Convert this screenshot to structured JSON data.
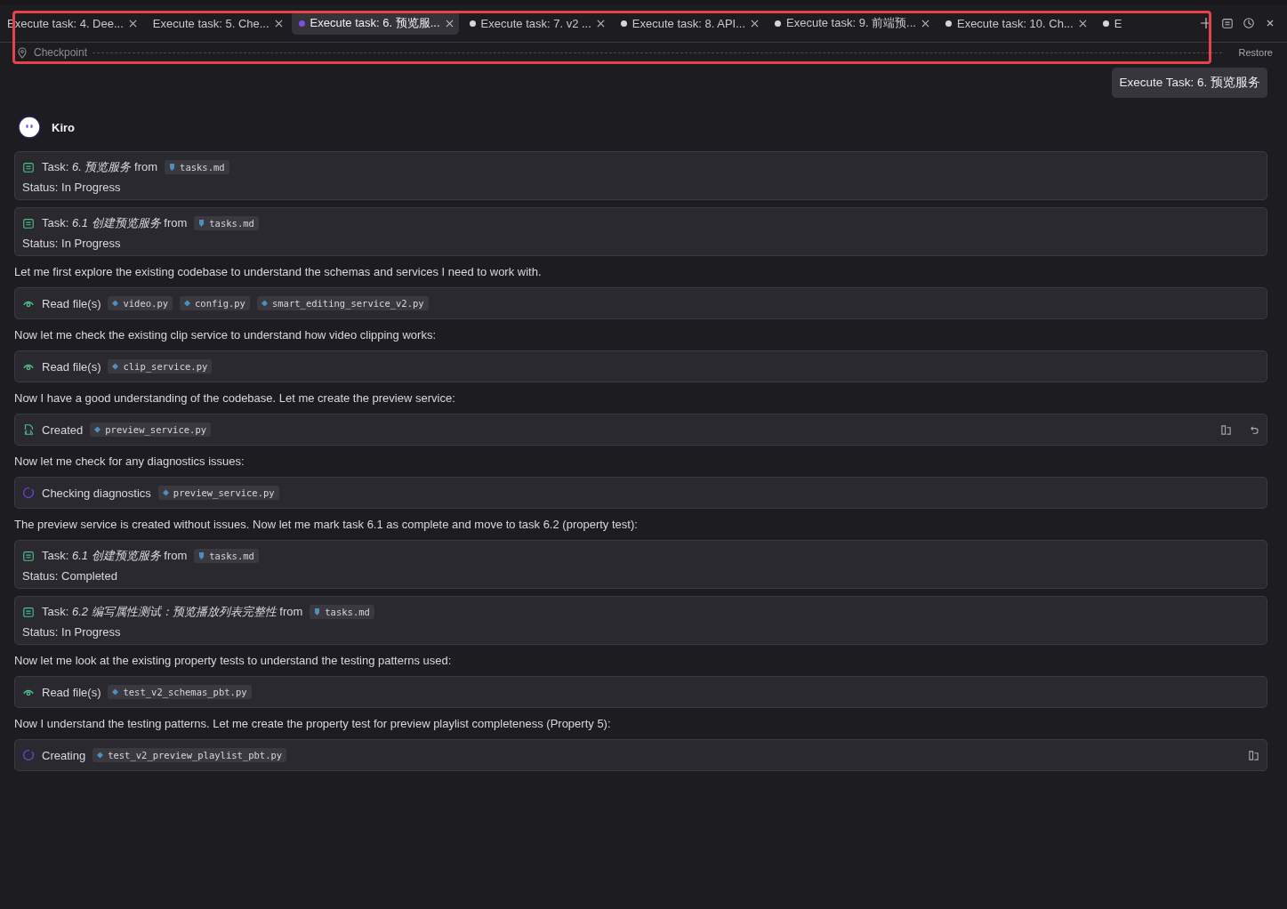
{
  "tabs": [
    {
      "label": "Execute task: 4. Dee...",
      "selected": false
    },
    {
      "label": "Execute task: 5. Che...",
      "selected": false
    },
    {
      "label": "Execute task: 6. 预览服...",
      "selected": true,
      "color": "#7b4fe0"
    },
    {
      "label": "Execute task: 7. v2 ...",
      "selected": false,
      "color": "#d6d6d8"
    },
    {
      "label": "Execute task: 8. API...",
      "selected": false,
      "color": "#d6d6d8"
    },
    {
      "label": "Execute task: 9. 前端预...",
      "selected": false,
      "color": "#d6d6d8"
    },
    {
      "label": "Execute task: 10. Ch...",
      "selected": false,
      "color": "#d6d6d8"
    },
    {
      "label": "E",
      "selected": false,
      "color": "#d6d6d8",
      "partial": true
    }
  ],
  "checkpoint": {
    "label": "Checkpoint",
    "action": "Restore"
  },
  "user_message": "Execute Task: 6. 预览服务",
  "agent": {
    "name": "Kiro"
  },
  "messages": [
    {
      "kind": "task",
      "title": "Task: *6. 预览服务* from",
      "files": [
        "tasks.md"
      ],
      "status": "Status: In Progress"
    },
    {
      "kind": "task",
      "title": "Task: *6.1 创建预览服务* from",
      "files": [
        "tasks.md"
      ],
      "status": "Status: In Progress"
    },
    {
      "kind": "text",
      "text": "Let me first explore the existing codebase to understand the schemas and services I need to work with."
    },
    {
      "kind": "read",
      "label": "Read file(s)",
      "files": [
        "video.py",
        "config.py",
        "smart_editing_service_v2.py"
      ]
    },
    {
      "kind": "text",
      "text": "Now let me check the existing clip service to understand how video clipping works:"
    },
    {
      "kind": "read",
      "label": "Read file(s)",
      "files": [
        "clip_service.py"
      ]
    },
    {
      "kind": "text",
      "text": "Now I have a good understanding of the codebase. Let me create the preview service:"
    },
    {
      "kind": "created",
      "label": "Created",
      "files": [
        "preview_service.py"
      ]
    },
    {
      "kind": "text",
      "text": "Now let me check for any diagnostics issues:"
    },
    {
      "kind": "checking",
      "label": "Checking diagnostics",
      "files": [
        "preview_service.py"
      ]
    },
    {
      "kind": "text",
      "text": "The preview service is created without issues. Now let me mark task 6.1 as complete and move to task 6.2 (property test):"
    },
    {
      "kind": "task",
      "title": "Task: *6.1 创建预览服务* from",
      "files": [
        "tasks.md"
      ],
      "status": "Status: Completed"
    },
    {
      "kind": "task",
      "title": "Task: *6.2 编写属性测试：预览播放列表完整性* from",
      "files": [
        "tasks.md"
      ],
      "status": "Status: In Progress"
    },
    {
      "kind": "text",
      "text": "Now let me look at the existing property tests to understand the testing patterns used:"
    },
    {
      "kind": "read",
      "label": "Read file(s)",
      "files": [
        "test_v2_schemas_pbt.py"
      ]
    },
    {
      "kind": "text",
      "text": "Now I understand the testing patterns. Let me create the property test for preview playlist completeness (Property 5):"
    },
    {
      "kind": "creating",
      "label": "Creating",
      "files": [
        "test_v2_preview_playlist_pbt.py"
      ]
    }
  ]
}
